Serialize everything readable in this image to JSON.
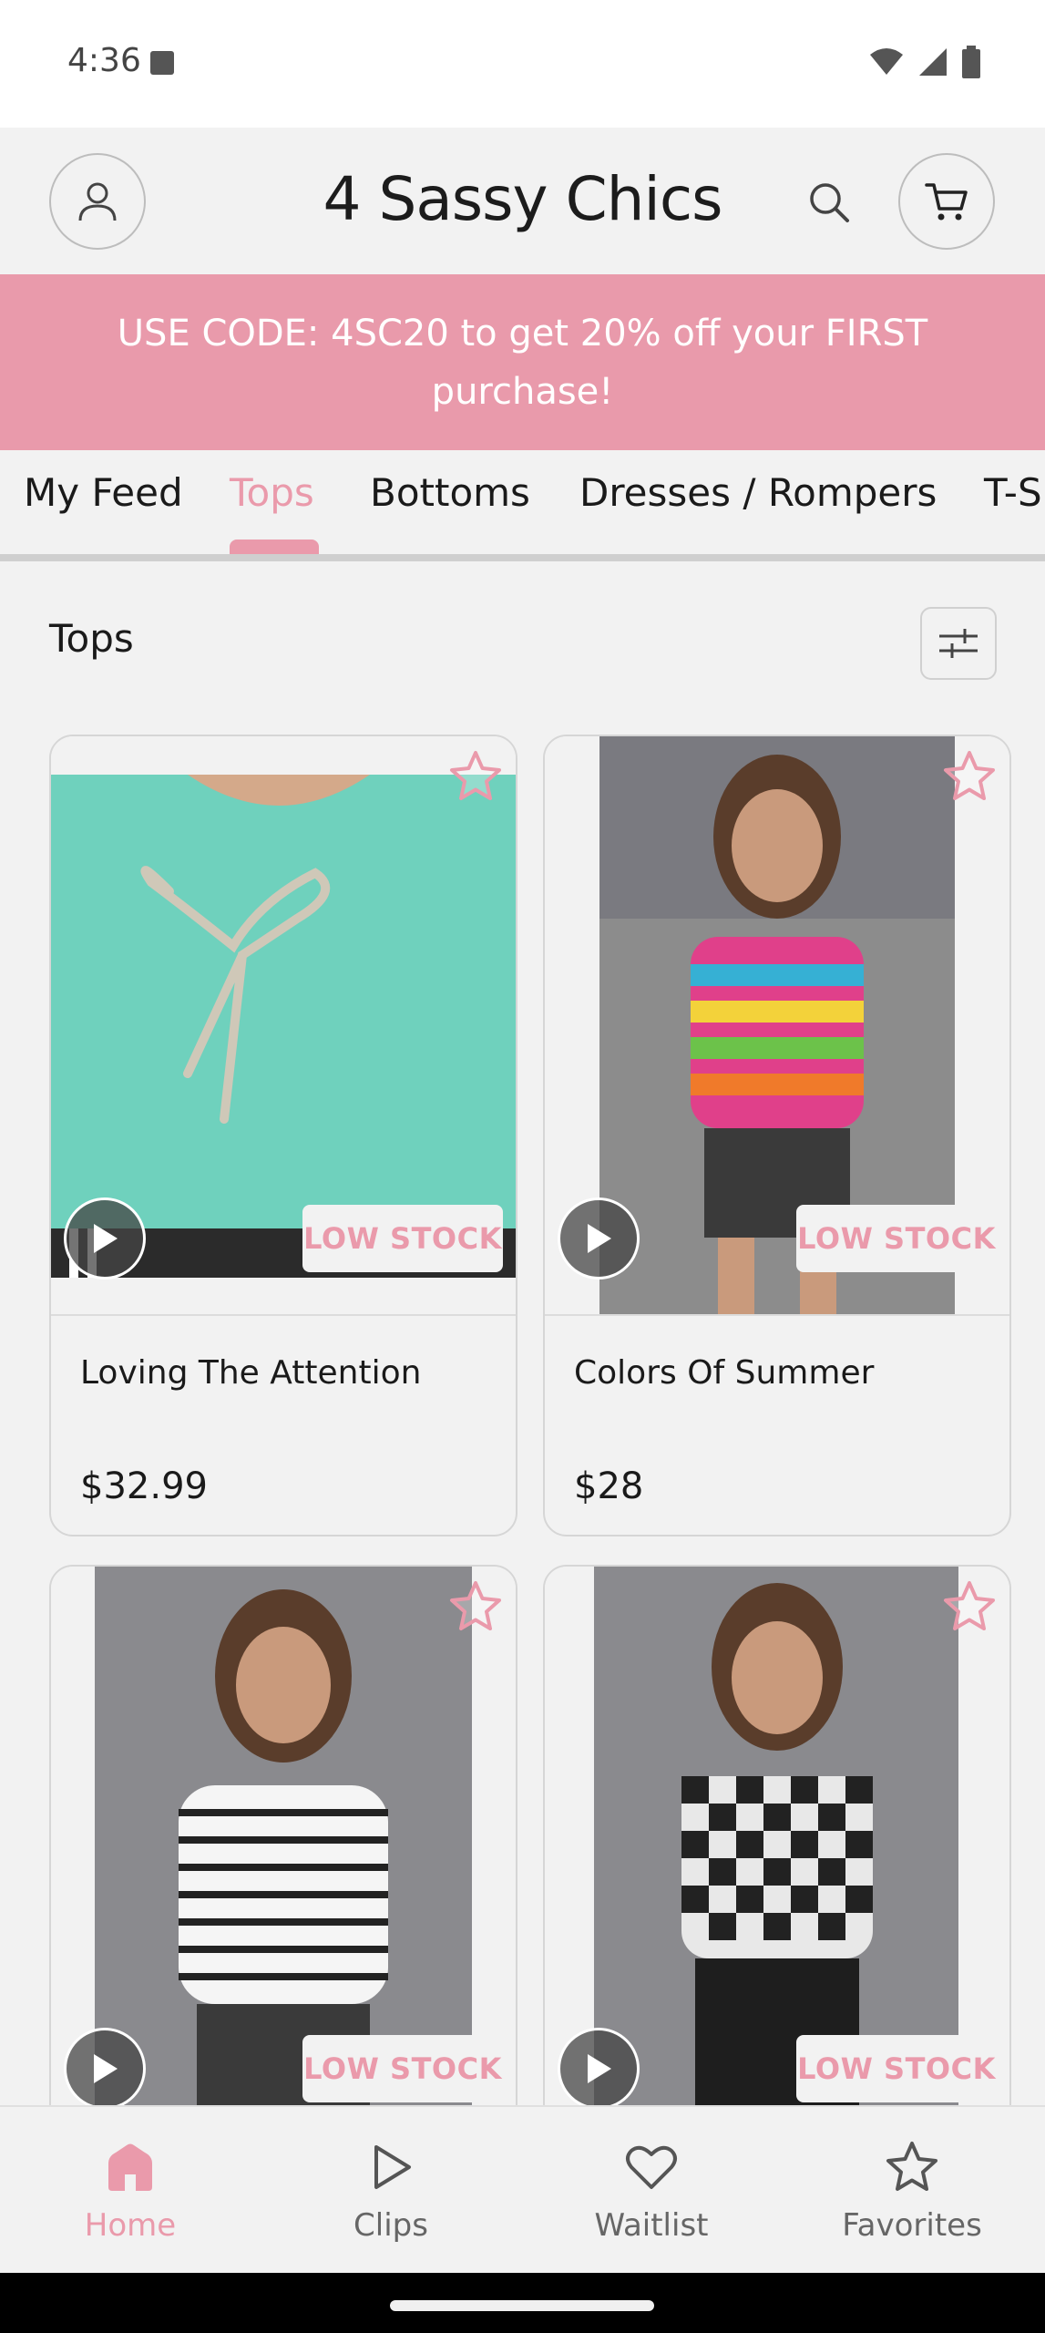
{
  "status_bar": {
    "time": "4:36"
  },
  "header": {
    "title": "4 Sassy Chics"
  },
  "promo": {
    "text": "USE CODE: 4SC20 to get 20% off your FIRST purchase!"
  },
  "tabs": [
    {
      "label": "My Feed"
    },
    {
      "label": "Tops"
    },
    {
      "label": "Bottoms"
    },
    {
      "label": "Dresses / Rompers"
    },
    {
      "label": "T-S"
    }
  ],
  "section": {
    "title": "Tops"
  },
  "products": [
    {
      "name": "Loving The Attention",
      "price": "$32.99",
      "badge": "LOW STOCK"
    },
    {
      "name": "Colors Of Summer",
      "price": "$28",
      "badge": "LOW STOCK"
    },
    {
      "name": "",
      "price": "",
      "badge": "LOW STOCK"
    },
    {
      "name": "",
      "price": "",
      "badge": "LOW STOCK"
    }
  ],
  "bottom_nav": [
    {
      "label": "Home",
      "icon": "home-icon"
    },
    {
      "label": "Clips",
      "icon": "play-icon"
    },
    {
      "label": "Waitlist",
      "icon": "heart-icon"
    },
    {
      "label": "Favorites",
      "icon": "star-icon"
    }
  ],
  "colors": {
    "accent": "#ea9aab",
    "promo_bg": "#e99aab",
    "background": "#f2f2f2"
  }
}
